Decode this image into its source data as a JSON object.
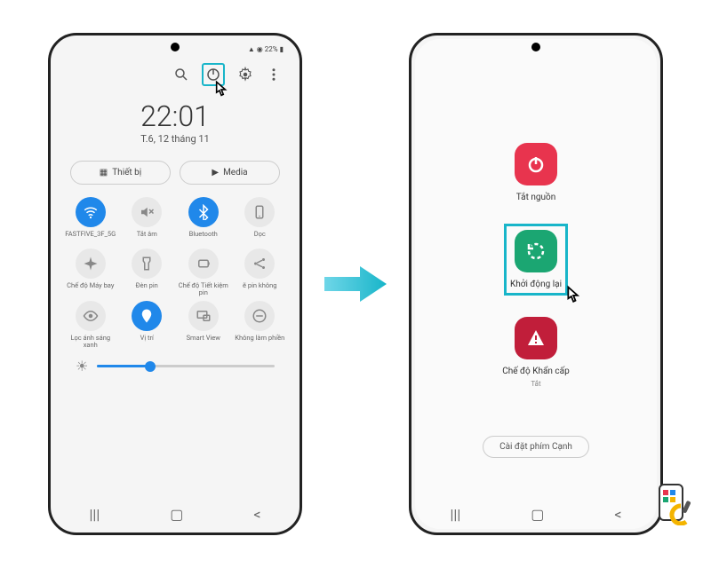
{
  "status": {
    "battery": "22%"
  },
  "clock": {
    "time": "22:01",
    "date": "T.6, 12 tháng 11"
  },
  "pills": {
    "devices": "Thiết bị",
    "media": "Media"
  },
  "qs": [
    {
      "label": "FASTFIVE_3F_5G",
      "icon": "wifi",
      "active": true
    },
    {
      "label": "Tắt âm",
      "icon": "mute",
      "active": false
    },
    {
      "label": "Bluetooth",
      "icon": "bluetooth",
      "active": true
    },
    {
      "label": "Dọc",
      "icon": "portrait",
      "active": false
    },
    {
      "label": "Chế độ Máy bay",
      "icon": "airplane",
      "active": false
    },
    {
      "label": "Đèn pin",
      "icon": "flashlight",
      "active": false
    },
    {
      "label": "Chế độ Tiết kiệm pin",
      "icon": "battery",
      "active": false
    },
    {
      "label": "ẽ pin không",
      "icon": "share",
      "active": false
    },
    {
      "label": "Lọc ánh sáng xanh",
      "icon": "eye",
      "active": false
    },
    {
      "label": "Vị trí",
      "icon": "location",
      "active": true
    },
    {
      "label": "Smart View",
      "icon": "smartview",
      "active": false
    },
    {
      "label": "Không làm phiền",
      "icon": "dnd",
      "active": false
    }
  ],
  "power": {
    "off": "Tắt nguồn",
    "restart": "Khởi động lại",
    "emergency": "Chế độ Khẩn cấp",
    "emergency_sub": "Tắt",
    "edge": "Cài đặt phím Cạnh"
  }
}
